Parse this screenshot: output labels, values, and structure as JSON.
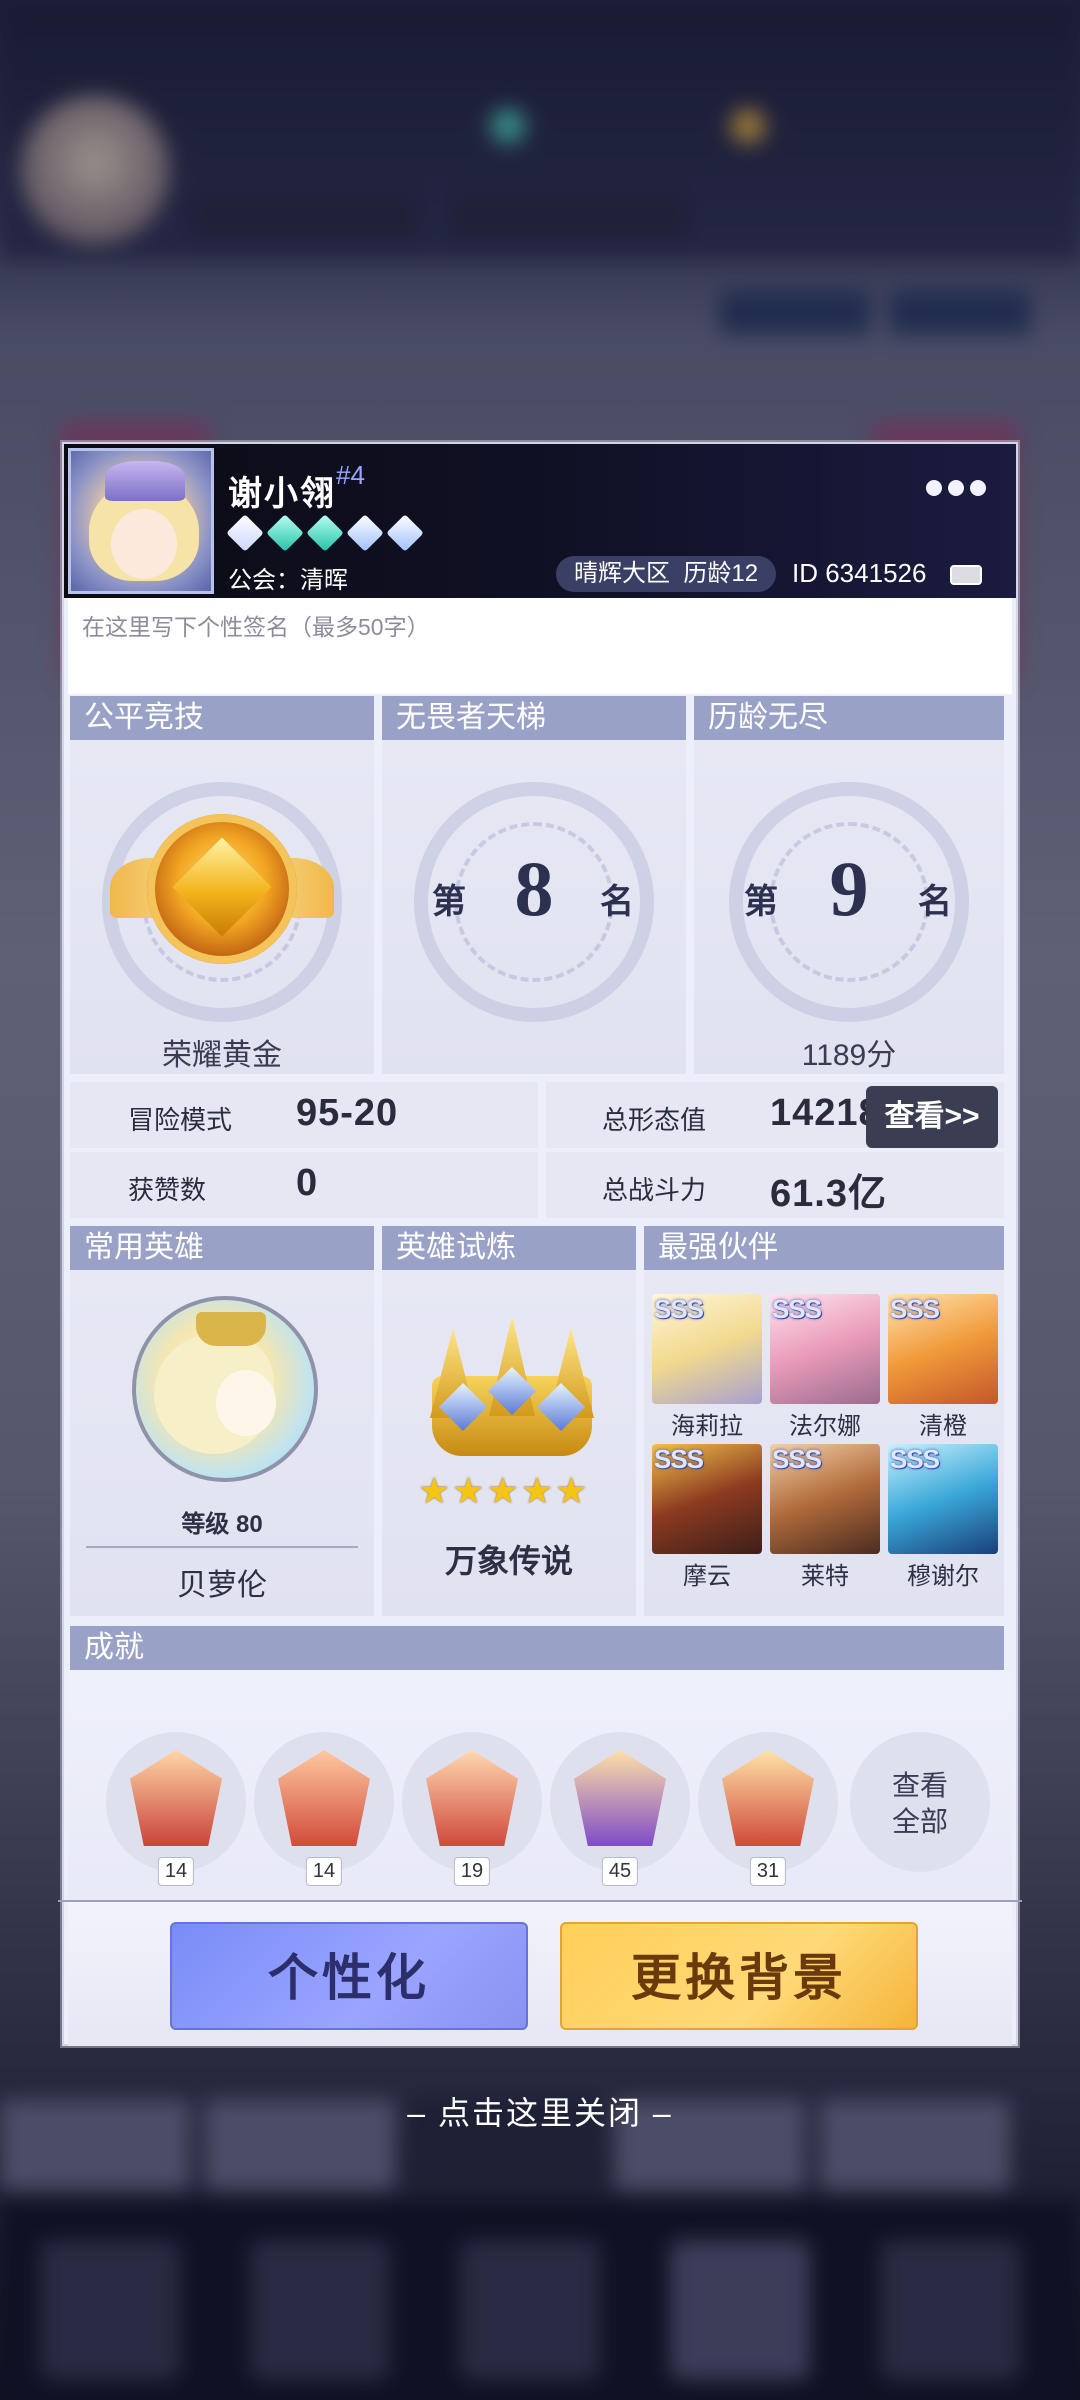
{
  "player": {
    "name": "谢小翎",
    "rank_tag": "#4",
    "guild": "公会：清晖",
    "server": "晴辉大区",
    "age": "历龄12",
    "id": "ID 6341526"
  },
  "signature_placeholder": "在这里写下个性签名（最多50字）",
  "ranks": [
    {
      "title": "公平竞技",
      "label": "荣耀黄金"
    },
    {
      "title": "无畏者天梯",
      "prefix": "第",
      "place": "8",
      "suffix": "名"
    },
    {
      "title": "历龄无尽",
      "prefix": "第",
      "place": "9",
      "suffix": "名",
      "score": "1189分"
    }
  ],
  "stats": {
    "adventure_label": "冒险模式",
    "adventure_value": "95-20",
    "likes_label": "获赞数",
    "likes_value": "0",
    "form_label": "总形态值",
    "form_value": "142182",
    "power_label": "总战斗力",
    "power_value": "61.3亿",
    "view_button": "查看>>"
  },
  "sections": {
    "common_hero": "常用英雄",
    "hero_trial": "英雄试炼",
    "partners": "最强伙伴",
    "achievements": "成就"
  },
  "common_hero": {
    "level": "等级 80",
    "name": "贝萝伦"
  },
  "hero_trial": {
    "label": "万象传说",
    "stars": 5
  },
  "partners": [
    {
      "grade": "SSS",
      "name": "海莉拉"
    },
    {
      "grade": "SSS",
      "name": "法尔娜"
    },
    {
      "grade": "SSS",
      "name": "清橙"
    },
    {
      "grade": "SSS",
      "name": "摩云"
    },
    {
      "grade": "SSS",
      "name": "莱特"
    },
    {
      "grade": "SSS",
      "name": "穆谢尔"
    }
  ],
  "achievements": [
    {
      "count": "14"
    },
    {
      "count": "14"
    },
    {
      "count": "19"
    },
    {
      "count": "45"
    },
    {
      "count": "31"
    }
  ],
  "view_all": "查看全部",
  "buttons": {
    "personalize": "个性化",
    "change_bg": "更换背景"
  },
  "close_hint": "– 点击这里关闭 –"
}
